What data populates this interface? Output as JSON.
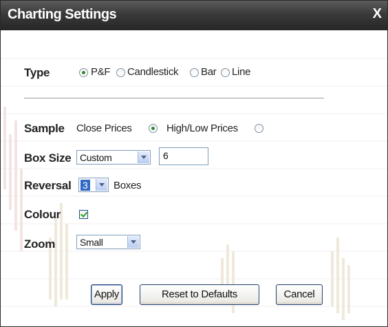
{
  "dialog": {
    "title": "Charting Settings",
    "close_label": "X"
  },
  "type": {
    "label": "Type",
    "options": [
      "P&F",
      "Candlestick",
      "Bar",
      "Line"
    ],
    "selected": "P&F"
  },
  "sample": {
    "label": "Sample",
    "options": [
      "Close Prices",
      "High/Low Prices"
    ],
    "selected": "Close Prices"
  },
  "box_size": {
    "label": "Box Size",
    "select_value": "Custom",
    "input_value": "6"
  },
  "reversal": {
    "label": "Reversal",
    "select_value": "3",
    "suffix": "Boxes"
  },
  "colour": {
    "label": "Colour",
    "checked": true
  },
  "zoom": {
    "label": "Zoom",
    "select_value": "Small"
  },
  "buttons": {
    "apply": "Apply",
    "reset": "Reset to Defaults",
    "cancel": "Cancel"
  },
  "colors": {
    "titlebar": "#2f2f2f",
    "radio_dot": "#2e8b2e",
    "checkmark": "#21a121",
    "select_highlight": "#316ac5"
  }
}
